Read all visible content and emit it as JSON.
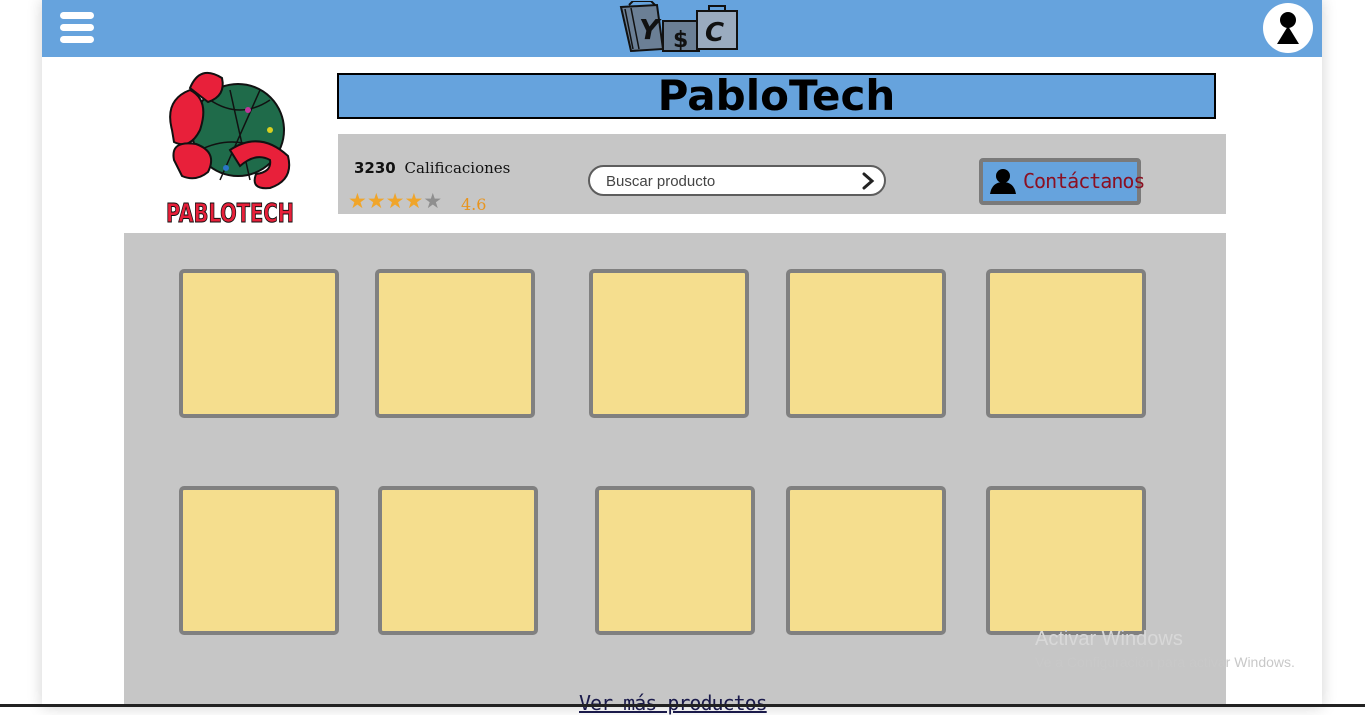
{
  "header": {
    "menu_icon": "hamburger-menu-icon",
    "logo_letters": [
      "Y",
      "$",
      "C"
    ],
    "user_icon": "user-icon"
  },
  "store": {
    "name": "PabloTech",
    "logo_text": "PABLOTECH",
    "ratings_count": "3230",
    "ratings_label": "Calificaciones",
    "rating_value": "4.6",
    "rating": 4.6,
    "stars_filled": 4,
    "stars_total": 5
  },
  "search": {
    "placeholder": "Buscar producto",
    "icon": "chevron-right-icon"
  },
  "contact": {
    "label": "Contáctanos",
    "icon": "person-icon"
  },
  "products": {
    "count": 10,
    "more_label": "Ver más productos"
  },
  "watermark": {
    "line1": "Activar Windows",
    "line2": "Ve a Configuración para activar Windows."
  },
  "colors": {
    "header_blue": "#66a3dd",
    "panel_gray": "#c6c6c6",
    "product_yellow": "#f5de8e",
    "product_border": "#808080",
    "star_orange": "#f0a52a",
    "contact_text": "#8b1022"
  }
}
